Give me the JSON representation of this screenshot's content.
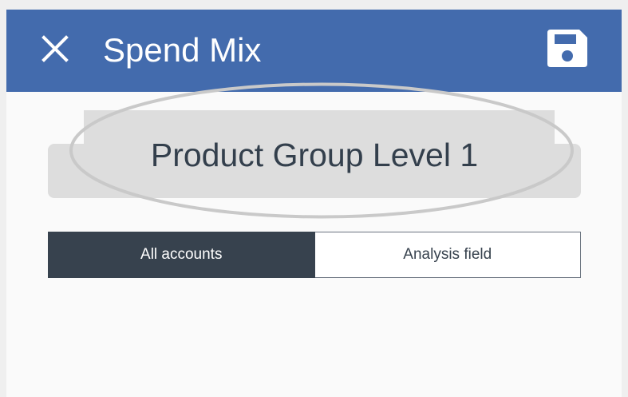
{
  "header": {
    "title": "Spend Mix",
    "close_icon": "close-icon",
    "save_icon": "save-icon",
    "background_color": "#436bad"
  },
  "main": {
    "group_label": "Product Group Level 1",
    "tabs": [
      {
        "label": "All accounts",
        "active": true
      },
      {
        "label": "Analysis field",
        "active": false
      }
    ],
    "active_tab_color": "#37424e"
  }
}
